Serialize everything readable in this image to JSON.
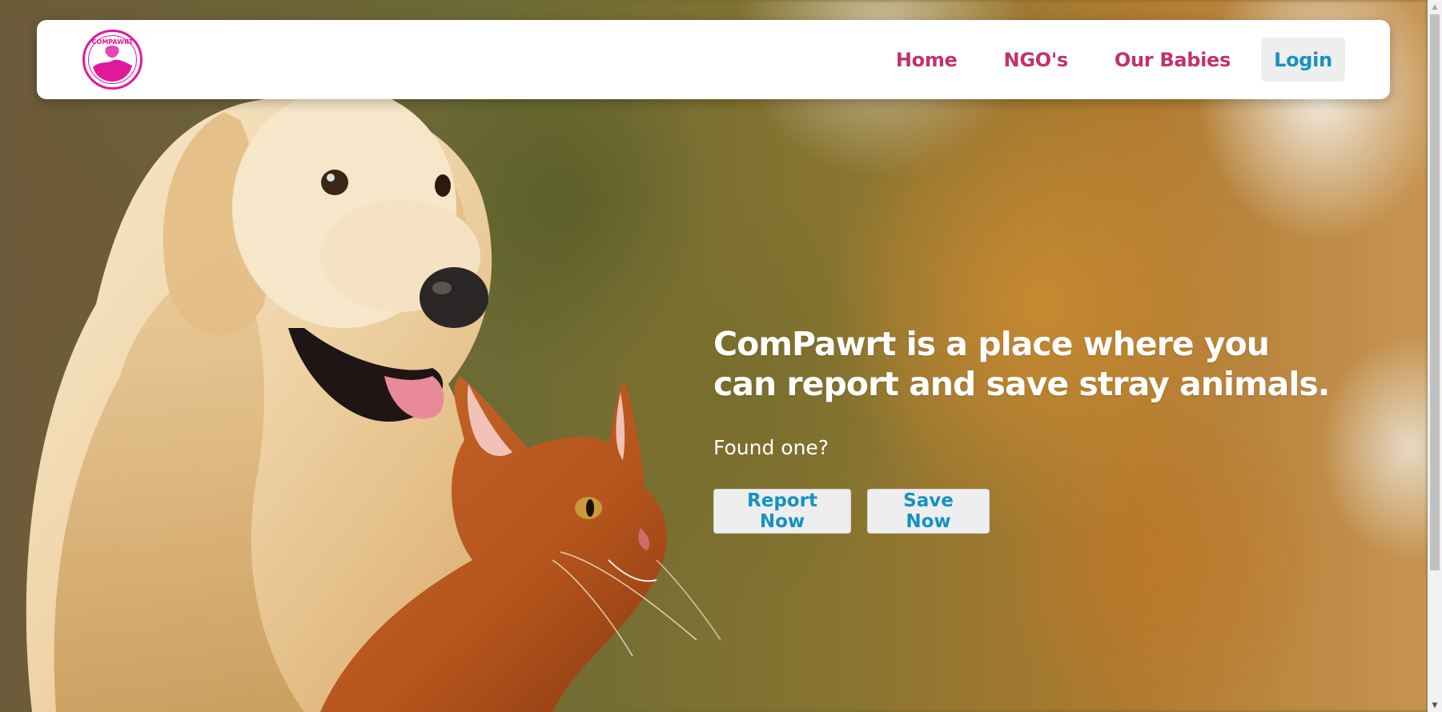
{
  "brand": {
    "logo_text": "COMPAWRT",
    "logo_color": "#e0199c"
  },
  "nav": {
    "items": [
      {
        "label": "Home"
      },
      {
        "label": "NGO's"
      },
      {
        "label": "Our Babies"
      }
    ],
    "login_label": "Login"
  },
  "hero": {
    "title": "ComPawrt is a place where you can report and save stray animals.",
    "subtitle": "Found one?",
    "buttons": {
      "report_label": "Report Now",
      "save_label": "Save Now"
    }
  },
  "colors": {
    "nav_link": "#c2326e",
    "button_text": "#1692c0",
    "button_bg": "#eeeeee"
  }
}
